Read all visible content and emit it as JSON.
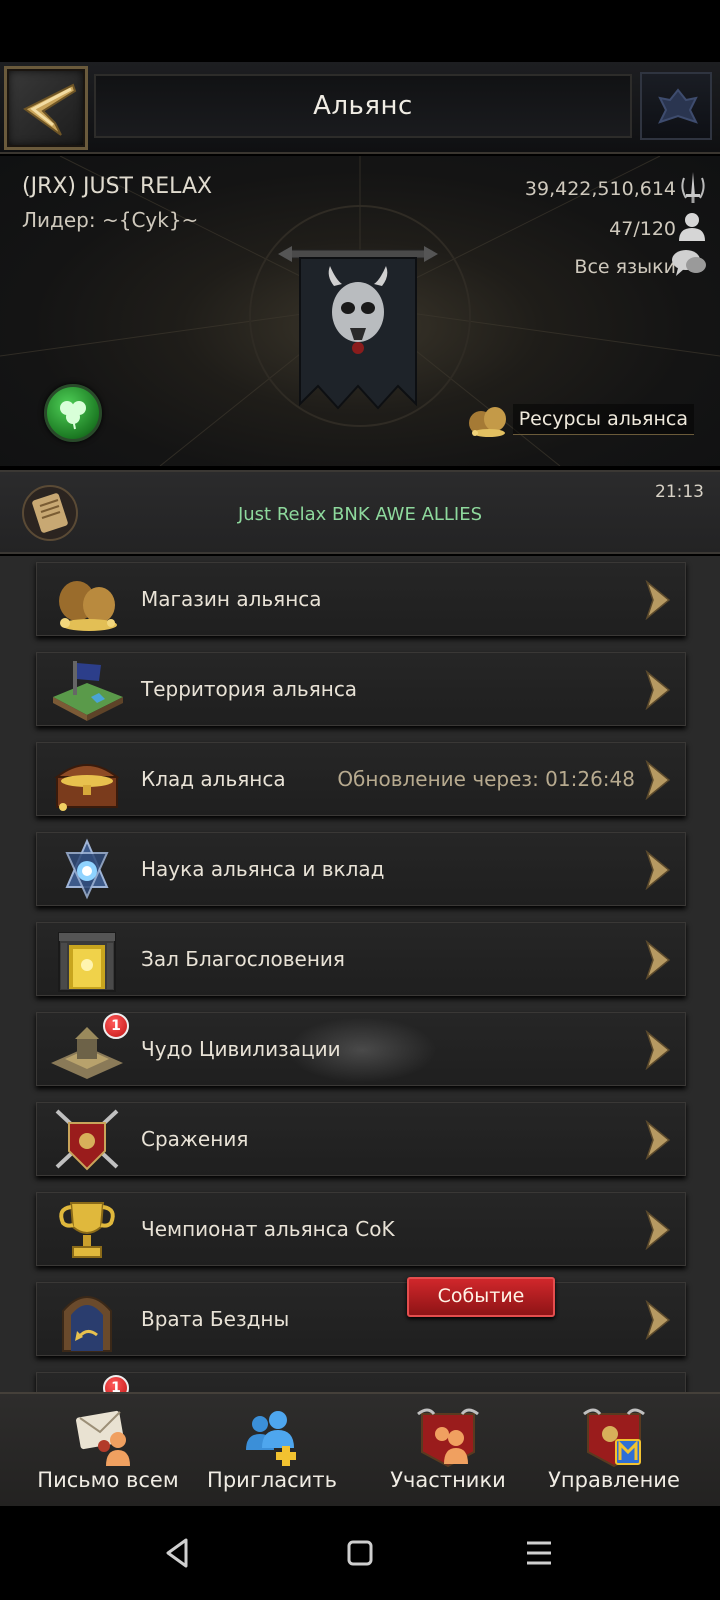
{
  "header": {
    "title": "Альянс"
  },
  "alliance": {
    "name": "(JRX) JUST RELAX",
    "leader": "Лидер: ~{Cyk}~",
    "power": "39,422,510,614",
    "members": "47/120",
    "language": "Все языки",
    "resources_label": "Ресурсы альянса"
  },
  "announcement": {
    "text": "Just Relax BNK AWE ALLIES",
    "time": "21:13"
  },
  "menu": [
    {
      "label": "Магазин альянса",
      "icon": "gold-bags-icon"
    },
    {
      "label": "Территория альянса",
      "icon": "territory-map-icon"
    },
    {
      "label": "Клад альянса",
      "icon": "treasure-chest-icon",
      "sub": "Обновление через: 01:26:48"
    },
    {
      "label": "Наука альянса и вклад",
      "icon": "science-star-icon"
    },
    {
      "label": "Зал Благословения",
      "icon": "blessing-hall-icon"
    },
    {
      "label": "Чудо Цивилизации",
      "icon": "wonder-icon",
      "badge": "1"
    },
    {
      "label": "Сражения",
      "icon": "crossed-swords-shield-icon"
    },
    {
      "label": "Чемпионат альянса CoK",
      "icon": "trophy-icon"
    },
    {
      "label": "Врата Бездны",
      "icon": "abyss-gate-icon",
      "tag": "Событие"
    },
    {
      "label": "",
      "icon": "partial-item-icon",
      "badge": "1"
    }
  ],
  "tabs": [
    {
      "label": "Письмо всем",
      "icon": "mail-all-icon"
    },
    {
      "label": "Пригласить",
      "icon": "invite-icon"
    },
    {
      "label": "Участники",
      "icon": "members-icon"
    },
    {
      "label": "Управление",
      "icon": "manage-icon"
    }
  ],
  "colors": {
    "announcement_text": "#8ed99d",
    "event_red": "#c41e22",
    "badge_red": "#d11a1a",
    "gold_accent": "#c9a45a"
  }
}
